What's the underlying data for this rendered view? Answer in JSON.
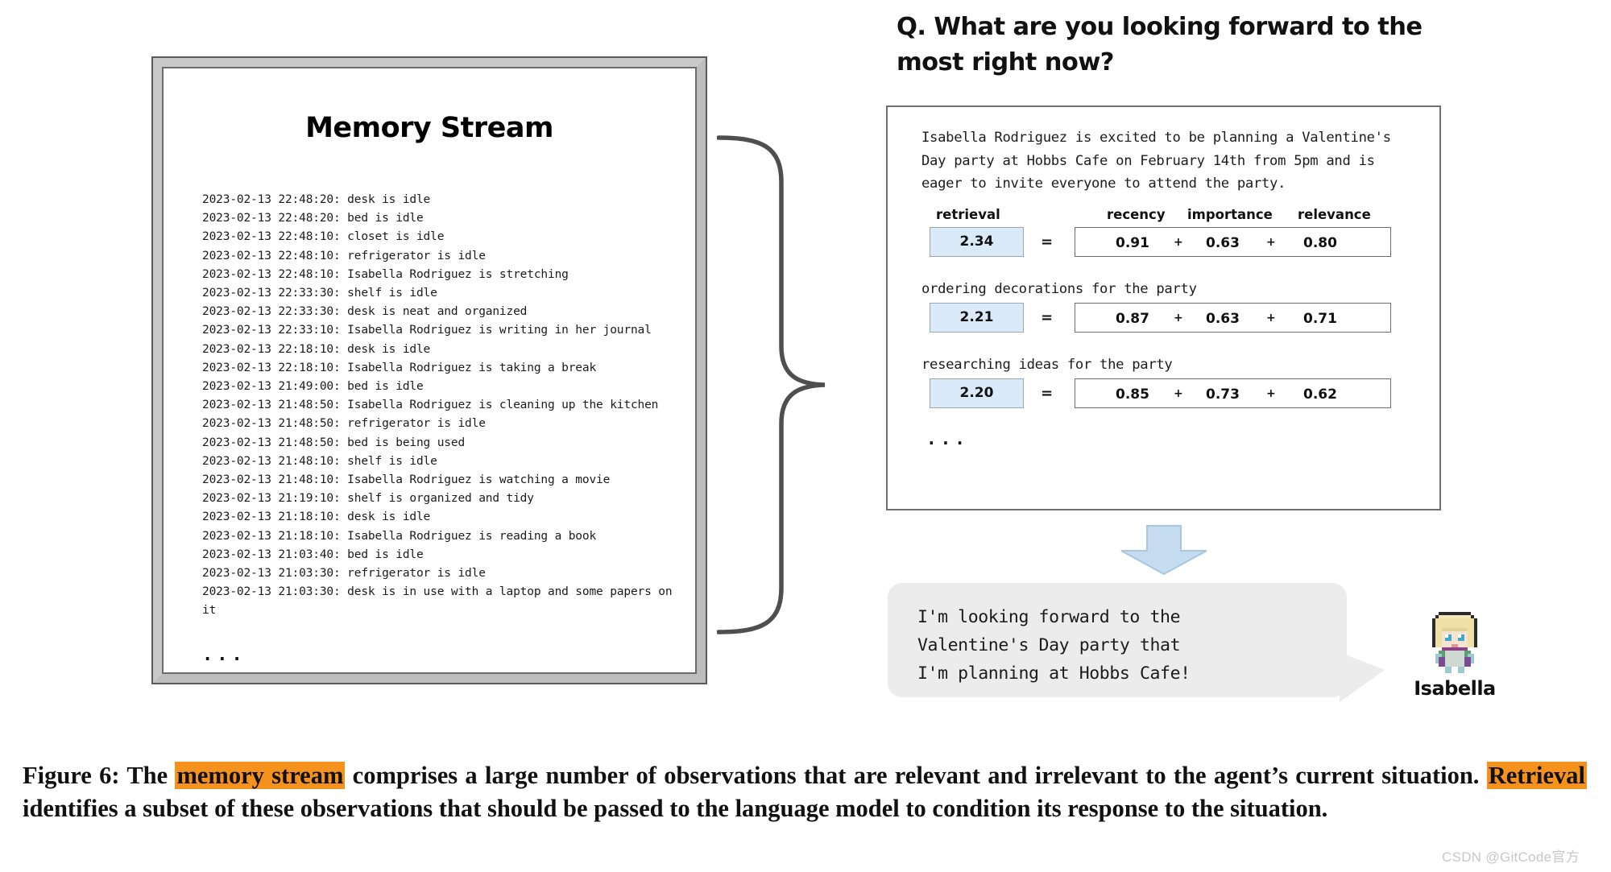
{
  "memory_panel": {
    "title": "Memory Stream",
    "lines": [
      "2023-02-13 22:48:20: desk is idle",
      "2023-02-13 22:48:20: bed is idle",
      "2023-02-13 22:48:10: closet is idle",
      "2023-02-13 22:48:10: refrigerator is idle",
      "2023-02-13 22:48:10: Isabella Rodriguez is stretching",
      "2023-02-13 22:33:30: shelf is idle",
      "2023-02-13 22:33:30: desk is neat and organized",
      "2023-02-13 22:33:10: Isabella Rodriguez is writing in her journal",
      "2023-02-13 22:18:10: desk is idle",
      "2023-02-13 22:18:10: Isabella Rodriguez is taking a break",
      "2023-02-13 21:49:00: bed is idle",
      "2023-02-13 21:48:50: Isabella Rodriguez is cleaning up the kitchen",
      "2023-02-13 21:48:50: refrigerator is idle",
      "2023-02-13 21:48:50: bed is being used",
      "2023-02-13 21:48:10: shelf is idle",
      "2023-02-13 21:48:10: Isabella Rodriguez is watching a movie",
      "2023-02-13 21:19:10: shelf is organized and tidy",
      "2023-02-13 21:18:10: desk is idle",
      "2023-02-13 21:18:10: Isabella Rodriguez is reading a book",
      "2023-02-13 21:03:40: bed is idle",
      "2023-02-13 21:03:30: refrigerator is idle",
      "2023-02-13 21:03:30: desk is in use with a laptop and some papers on it"
    ],
    "ellipsis": "..."
  },
  "question": {
    "text": "Q. What are you looking forward to the most right now?"
  },
  "retrieval_panel": {
    "context": "Isabella Rodriguez is excited to be planning a Valentine's Day party at Hobbs Cafe on February 14th from 5pm and is eager to invite everyone to attend the party.",
    "headers": {
      "retrieval": "retrieval",
      "recency": "recency",
      "importance": "importance",
      "relevance": "relevance"
    },
    "equals": "=",
    "plus": "+",
    "rows": [
      {
        "memory": "",
        "retrieval": "2.34",
        "recency": "0.91",
        "importance": "0.63",
        "relevance": "0.80"
      },
      {
        "memory": "ordering decorations for the party",
        "retrieval": "2.21",
        "recency": "0.87",
        "importance": "0.63",
        "relevance": "0.71"
      },
      {
        "memory": "researching ideas for the party",
        "retrieval": "2.20",
        "recency": "0.85",
        "importance": "0.73",
        "relevance": "0.62"
      }
    ],
    "ellipsis": "..."
  },
  "response": {
    "text": "I'm looking forward to the\nValentine's Day party that\nI'm planning at Hobbs Cafe!",
    "speaker": "Isabella"
  },
  "caption": {
    "prefix": "Figure 6: The ",
    "highlight1": "memory stream",
    "middle1": " comprises a large number of observations that are relevant and irrelevant to the agent’s current situation. ",
    "highlight2": "Retrieval",
    "middle2": " identifies a subset of these observations that should be passed to the language model to condition its response to the situation."
  },
  "watermark": {
    "text": "CSDN @GitCode官方"
  },
  "colors": {
    "highlight": "#f5921e",
    "retrieval_box": "#dbeaf8",
    "arrow": "#c5dcf0",
    "bubble": "#ececec"
  }
}
